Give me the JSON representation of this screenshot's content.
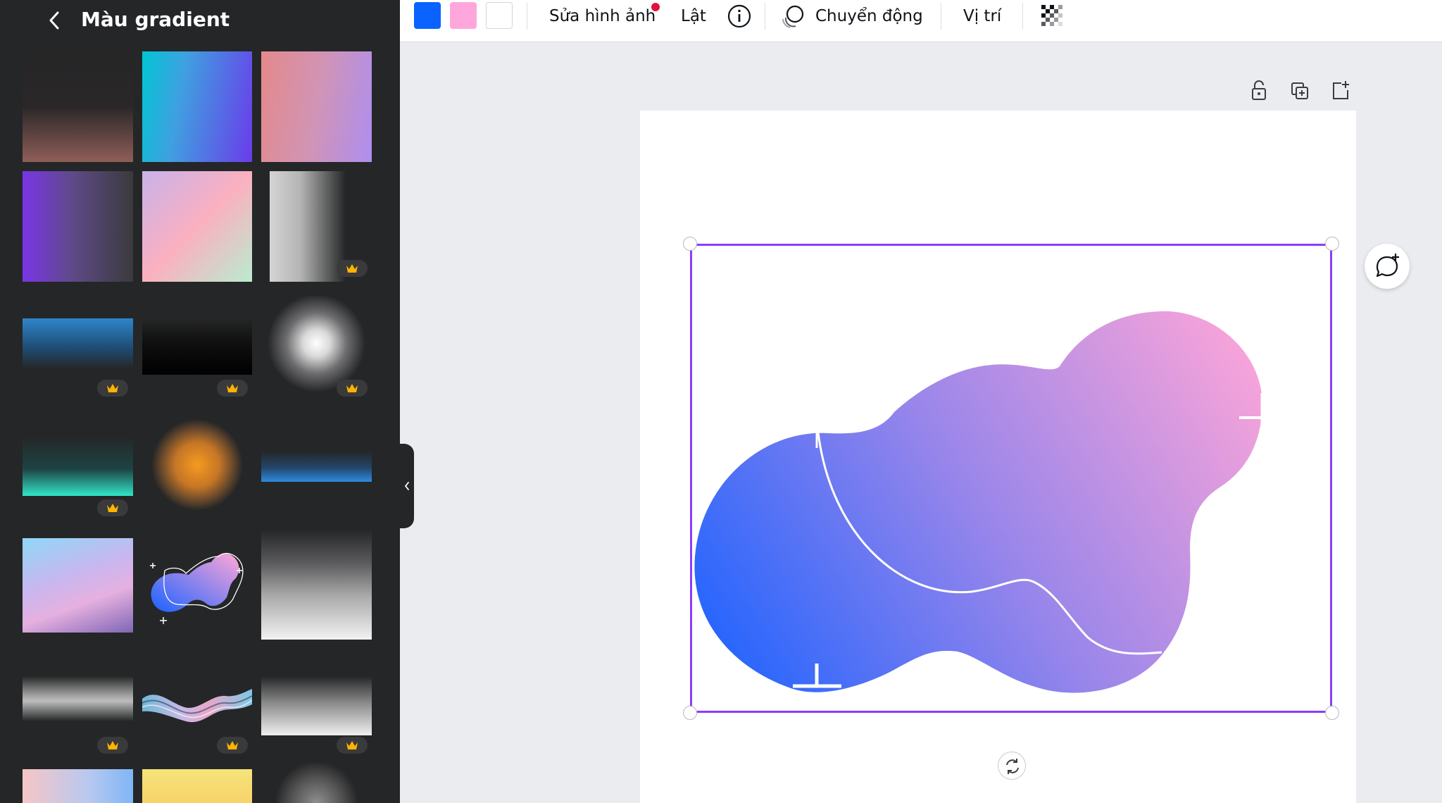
{
  "panel": {
    "title": "Màu gradient",
    "back_icon": "chevron-left-icon"
  },
  "gradients": [
    {
      "id": "g1",
      "premium": false
    },
    {
      "id": "g2",
      "premium": false
    },
    {
      "id": "g3",
      "premium": false
    },
    {
      "id": "g4",
      "premium": false
    },
    {
      "id": "g5",
      "premium": false
    },
    {
      "id": "g6",
      "premium": true
    },
    {
      "id": "g7",
      "premium": true
    },
    {
      "id": "g8",
      "premium": true
    },
    {
      "id": "g9",
      "premium": true
    },
    {
      "id": "g10",
      "premium": true
    },
    {
      "id": "g11",
      "premium": false
    },
    {
      "id": "g12",
      "premium": false
    },
    {
      "id": "g13",
      "premium": false
    },
    {
      "id": "g14",
      "premium": false
    },
    {
      "id": "g15",
      "premium": false
    },
    {
      "id": "g16",
      "premium": true
    },
    {
      "id": "g17",
      "premium": true
    },
    {
      "id": "g18",
      "premium": true
    },
    {
      "id": "g19",
      "premium": false
    },
    {
      "id": "g20",
      "premium": false
    },
    {
      "id": "g21",
      "premium": false
    }
  ],
  "toolbar": {
    "colors": [
      "#0a63ff",
      "#ffa6dd",
      "#ffffff"
    ],
    "edit_image": "Sửa hình ảnh",
    "flip": "Lật",
    "info_icon": "info-icon",
    "animate": "Chuyển động",
    "position": "Vị trí",
    "transparency_icon": "transparency-icon"
  },
  "canvas": {
    "page_actions": [
      "lock-icon",
      "duplicate-page-icon",
      "add-page-icon"
    ],
    "selected_element": "gradient-blob-graphic",
    "gradient_start": "#1a62ff",
    "gradient_end": "#ffa6d8",
    "selection_color": "#8b3dff",
    "comment_icon": "add-comment-icon",
    "rotate_icon": "rotate-icon"
  }
}
